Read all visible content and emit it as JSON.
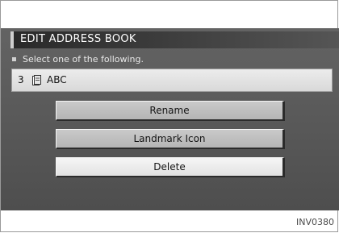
{
  "screen": {
    "title": "EDIT ADDRESS BOOK",
    "instruction": "Select one of the following.",
    "entry": {
      "number": "3",
      "icon": "landmark-icon",
      "name": "ABC"
    },
    "options": [
      {
        "label": "Rename",
        "selected": false
      },
      {
        "label": "Landmark Icon",
        "selected": false
      },
      {
        "label": "Delete",
        "selected": true
      }
    ]
  },
  "figure": {
    "reference_code": "INV0380"
  },
  "colors": {
    "screen_background": "#5a5a5a",
    "title_bar": "#2a2a2a",
    "button_default": "#bdbdbd",
    "button_selected": "#ececec"
  }
}
